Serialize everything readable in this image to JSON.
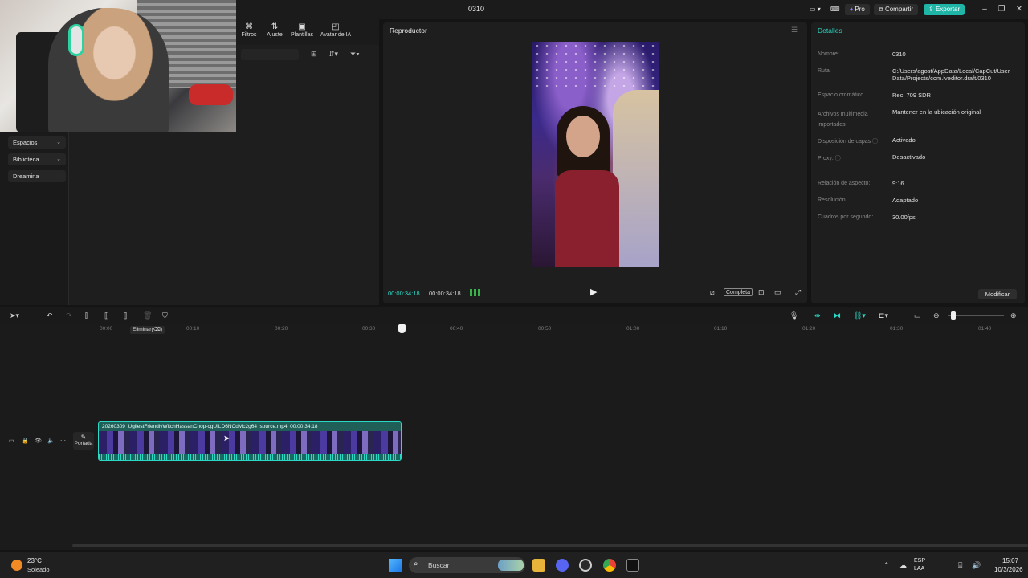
{
  "window": {
    "title": "0310",
    "pro_label": "Pro",
    "share_label": "Compartir",
    "export_label": "Exportar"
  },
  "media_tabs": [
    {
      "label": "Filtros",
      "icon": "filters-icon"
    },
    {
      "label": "Ajuste",
      "icon": "adjust-icon"
    },
    {
      "label": "Plantillas",
      "icon": "templates-icon"
    },
    {
      "label": "Avatar de IA",
      "icon": "ai-avatar-icon"
    }
  ],
  "sidebar": {
    "items": [
      {
        "label": "Espacios",
        "has_chevron": true
      },
      {
        "label": "Biblioteca",
        "has_chevron": true
      },
      {
        "label": "Dreamina",
        "has_chevron": false
      }
    ]
  },
  "player": {
    "title": "Reproductor",
    "timecode_current": "00:00:34:18",
    "timecode_total": "00:00:34:18",
    "ratio_button": "Completa"
  },
  "details": {
    "title": "Detalles",
    "fields": [
      {
        "label": "Nombre:",
        "value": "0310"
      },
      {
        "label": "Ruta:",
        "value": "C:/Users/agost/AppData/Local/CapCut/User Data/Projects/com.lveditor.draft/0310"
      },
      {
        "label": "Espacio cromático",
        "value": "Rec. 709 SDR"
      },
      {
        "label": "Archivos multimedia importados:",
        "value": "Mantener en la ubicación original"
      },
      {
        "label": "Disposición de capas ⓘ",
        "value": "Activado"
      },
      {
        "label": "Proxy: ⓘ",
        "value": "Desactivado"
      },
      {
        "label": "Relación de aspecto:",
        "value": "9:16"
      },
      {
        "label": "Resolución:",
        "value": "Adaptado"
      },
      {
        "label": "Cuadros por segundo:",
        "value": "30.00fps"
      }
    ],
    "modify_label": "Modificar"
  },
  "timeline": {
    "ruler": [
      "00:00",
      "00:10",
      "00:20",
      "00:30",
      "00:40",
      "00:50",
      "01:00",
      "01:10",
      "01:20",
      "01:30",
      "01:40"
    ],
    "delete_tooltip": "Eliminar(⌫)",
    "cover_label": "Portada",
    "clip_name": "20260309_UgliestFriendlyWitchHassanChop-cgUILD6NCdMc2g64_source.mp4",
    "clip_duration": "00:00:34:18"
  },
  "taskbar": {
    "temperature": "23°C",
    "condition": "Soleado",
    "search_placeholder": "Buscar",
    "lang_line1": "ESP",
    "lang_line2": "LAA",
    "time": "15:07",
    "date": "10/3/2026"
  },
  "colors": {
    "accent": "#2bd9c5",
    "export": "#1fb6a8"
  }
}
